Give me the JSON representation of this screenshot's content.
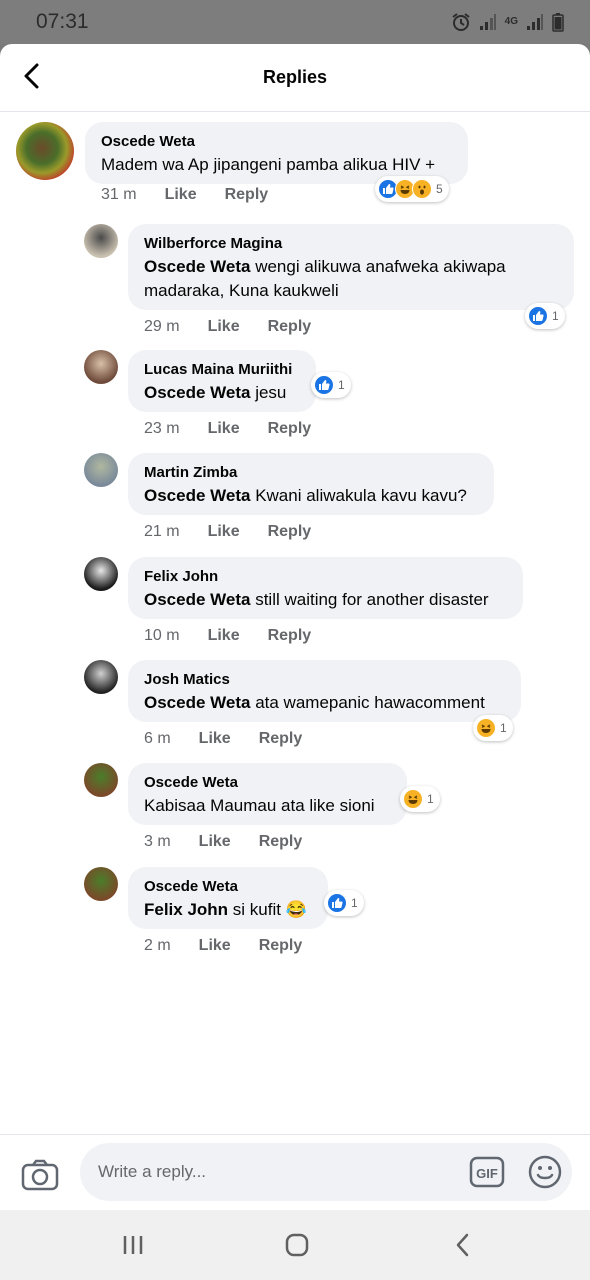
{
  "status_bar": {
    "time": "07:31",
    "network": "4G"
  },
  "header": {
    "title": "Replies",
    "back_icon": "back-arrow-icon"
  },
  "actions": {
    "like": "Like",
    "reply": "Reply"
  },
  "colors": {
    "accent": "#1b74e4",
    "bubble": "#f0f2f5",
    "meta": "#65676b",
    "haha": "#f7b125"
  },
  "main_comment": {
    "author": "Oscede Weta",
    "text": "Madem wa Ap jipangeni pamba alikua HIV +",
    "time": "31 m",
    "reactions": {
      "icons": [
        "like-reaction-icon",
        "haha-reaction-icon",
        "wow-reaction-icon"
      ],
      "count": "5"
    }
  },
  "replies": [
    {
      "author": "Wilberforce Magina",
      "mention": "Oscede Weta",
      "text": " wengi alikuwa anafweka akiwapa madaraka, Kuna kaukweli",
      "time": "29 m",
      "reactions": {
        "icons": [
          "like-reaction-icon"
        ],
        "count": "1"
      }
    },
    {
      "author": "Lucas Maina Muriithi",
      "mention": "Oscede Weta",
      "text": " jesu",
      "time": "23 m",
      "reactions": {
        "icons": [
          "like-reaction-icon"
        ],
        "count": "1"
      }
    },
    {
      "author": "Martin Zimba",
      "mention": "Oscede Weta",
      "text": " Kwani aliwakula kavu kavu?",
      "time": "21 m",
      "reactions": null
    },
    {
      "author": "Felix John",
      "mention": "Oscede Weta",
      "text": " still waiting for another disaster",
      "time": "10 m",
      "reactions": null
    },
    {
      "author": "Josh Matics",
      "mention": "Oscede Weta",
      "text": " ata wamepanic hawacomment",
      "time": "6 m",
      "reactions": {
        "icons": [
          "haha-reaction-icon"
        ],
        "count": "1"
      }
    },
    {
      "author": "Oscede Weta",
      "mention": "",
      "text": "Kabisaa Maumau ata like sioni",
      "time": "3 m",
      "reactions": {
        "icons": [
          "haha-reaction-icon"
        ],
        "count": "1"
      }
    },
    {
      "author": "Oscede Weta",
      "mention": "Felix John",
      "text": " si kufit ",
      "emoji": "😂",
      "time": "2 m",
      "reactions": {
        "icons": [
          "like-reaction-icon"
        ],
        "count": "1"
      }
    }
  ],
  "composer": {
    "placeholder": "Write a reply...",
    "gif_label": "GIF"
  },
  "nav_bar": {
    "icons": [
      "recent-apps-icon",
      "home-icon",
      "back-icon"
    ]
  }
}
